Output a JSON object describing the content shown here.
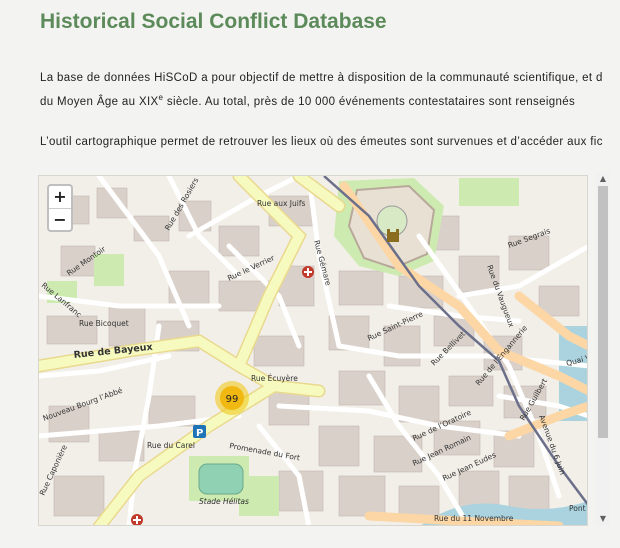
{
  "page": {
    "title": "Historical Social Conflict Database",
    "intro_line1": "La base de données HiSCoD a pour objectif de mettre à disposition de la communauté scientifique, et d",
    "intro_line2_before": "du Moyen Âge au XIX",
    "intro_line2_sup": "e",
    "intro_line2_after": " siècle. Au total, près de 10 000 événements contestataires sont renseignés",
    "intro_line3": "L’outil cartographique permet de retrouver les lieux où des émeutes sont survenues et d’accéder aux fic"
  },
  "map": {
    "zoom_in": "+",
    "zoom_out": "−",
    "cluster_count": "99",
    "parking_label": "P",
    "streets": {
      "rue_aux_juifs": "Rue aux Juifs",
      "rue_des_rosiers": "Rue des Rosiers",
      "rue_montoir": "Rue Montoir",
      "rue_lanfranc": "Rue Lanfranc",
      "rue_le_verrier": "Rue le Verrier",
      "rue_gemare": "Rue Gémare",
      "rue_segrais": "Rue Segrais",
      "rue_du_vaugueux": "Rue du Vaugueux",
      "rue_bicoquet": "Rue Bicoquet",
      "rue_saint_pierre": "Rue Saint-Pierre",
      "rue_de_bayeux": "Rue de Bayeux",
      "rue_ecuyere": "Rue Écuyère",
      "rue_belivet": "Rue Bellivet",
      "rue_de_l_engannerie": "Rue de l’Engannerie",
      "quai_vendeuvre": "Quai Ve",
      "rue_guilbert": "Rue Guilbert",
      "avenue_du_6_juin": "Avenue du 6 Juin",
      "rue_de_l_oratoire": "Rue de l’Oratoire",
      "rue_jean_romain": "Rue Jean Romain",
      "rue_jean_eudes": "Rue Jean Eudes",
      "nouveau_bourg_l_abbe": "Nouveau Bourg l’Abbé",
      "rue_du_carel": "Rue du Carel",
      "promenade_du_fort": "Promenade du Fort",
      "rue_caponiere": "Rue Caponière",
      "stade_helitas": "Stade Hélitas",
      "rue_du_11_novembre": "Rue du 11 Novembre",
      "pont": "Pont"
    }
  },
  "scrollbar": {
    "up": "▲",
    "down": "▼"
  },
  "colors": {
    "title": "#5c8a5a",
    "cluster": "#f1c40f",
    "main_road": "#f7fabf",
    "railway": "#6b6f8a",
    "park": "#cdebb0",
    "water": "#aad3df"
  }
}
